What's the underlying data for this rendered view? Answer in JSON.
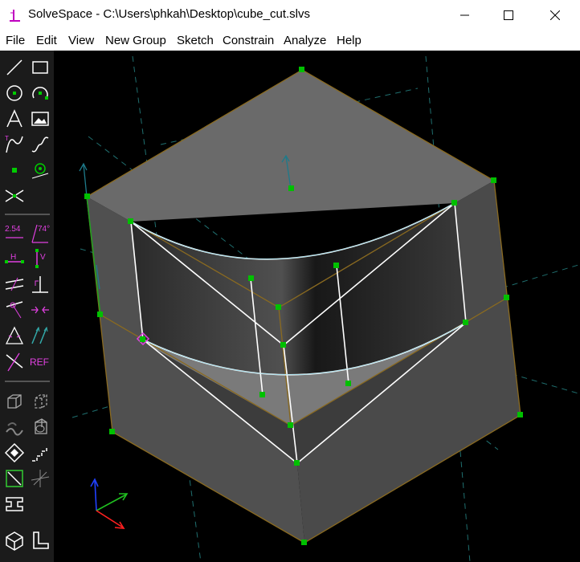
{
  "window": {
    "title": "SolveSpace - C:\\Users\\phkah\\Desktop\\cube_cut.slvs"
  },
  "menu": [
    {
      "label": "File"
    },
    {
      "label": "Edit"
    },
    {
      "label": "View"
    },
    {
      "label": "New Group"
    },
    {
      "label": "Sketch"
    },
    {
      "label": "Constrain"
    },
    {
      "label": "Analyze"
    },
    {
      "label": "Help"
    }
  ],
  "toolbar": {
    "dimension_label": "2.54",
    "angle_label": "74°",
    "horizontal_label": "H",
    "vertical_label": "V",
    "reference_label": "REF"
  },
  "colors": {
    "constraint": "#e040e0",
    "point": "#00c000",
    "edge": "#ffffff",
    "face": "#5a5a5a",
    "axis_x": "#ff2020",
    "axis_y": "#20c020",
    "axis_z": "#2040ff"
  }
}
